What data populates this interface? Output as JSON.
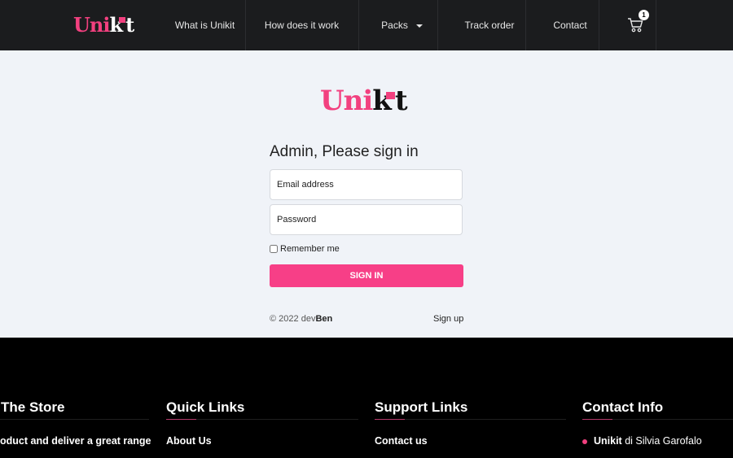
{
  "brand": {
    "logo_text": "Unikit",
    "logo_pink": "Uni",
    "logo_rest_a": "k",
    "logo_rest_b": "t"
  },
  "nav": {
    "items": [
      "What is Unikit",
      "How does it work",
      "Packs",
      "Track order",
      "Contact"
    ],
    "cart_count": "1"
  },
  "login": {
    "title": "Admin, Please sign in",
    "email_placeholder": "Email address",
    "password_placeholder": "Password",
    "remember": "Remember me",
    "submit": "SIGN IN",
    "copyright": "© 2022 ",
    "author_a": "dev",
    "author_b": "Ben",
    "signup": "Sign up"
  },
  "footer": {
    "store_heading": "The Store",
    "store_text": "oduct and deliver a great range",
    "quick_heading": "Quick Links",
    "quick_links": [
      "About Us"
    ],
    "support_heading": "Support Links",
    "support_links": [
      "Contact us"
    ],
    "contact_heading": "Contact Info",
    "contact_name": "Unikit",
    "contact_rest": " di Silvia Garofalo"
  },
  "colors": {
    "accent": "#f73f87",
    "nav_bg": "#1b1c1e",
    "main_bg": "#f0f3f8",
    "footer_bg": "#000000"
  }
}
